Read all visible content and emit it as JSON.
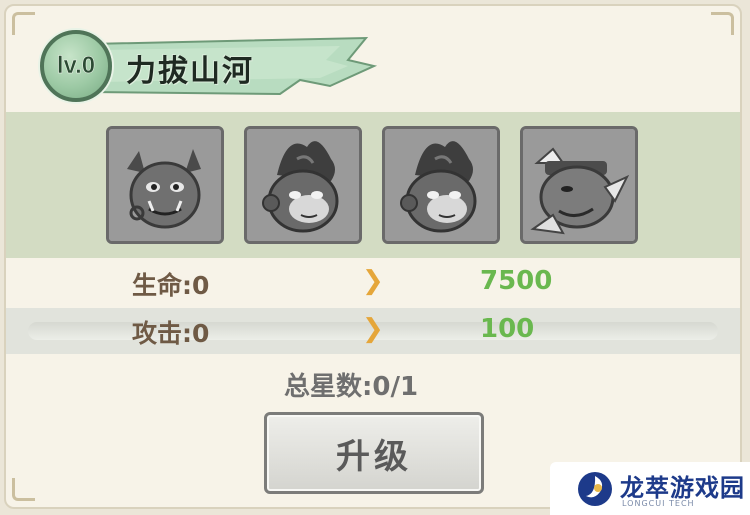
{
  "skill": {
    "level_label": "lv.0",
    "name": "力拔山河"
  },
  "heroes": [
    {
      "icon": "boar-demon-portrait-icon"
    },
    {
      "icon": "monkey-warrior-portrait-icon"
    },
    {
      "icon": "monkey-warrior-portrait-icon"
    },
    {
      "icon": "rhino-warrior-portrait-icon"
    }
  ],
  "stats": [
    {
      "label": "生命:0",
      "arrow": "❯",
      "value": "7500"
    },
    {
      "label": "攻击:0",
      "arrow": "❯",
      "value": "100"
    }
  ],
  "total_stars": "总星数:0/1",
  "upgrade_button": "升级",
  "watermark": {
    "name": "龙萃游戏园",
    "sub": "LONGCUI TECH"
  },
  "colors": {
    "stat_value": "#6ab84f",
    "arrow": "#e5a63a",
    "badge": "#9cc9a4",
    "hero_strip": "#d3dcc3"
  }
}
